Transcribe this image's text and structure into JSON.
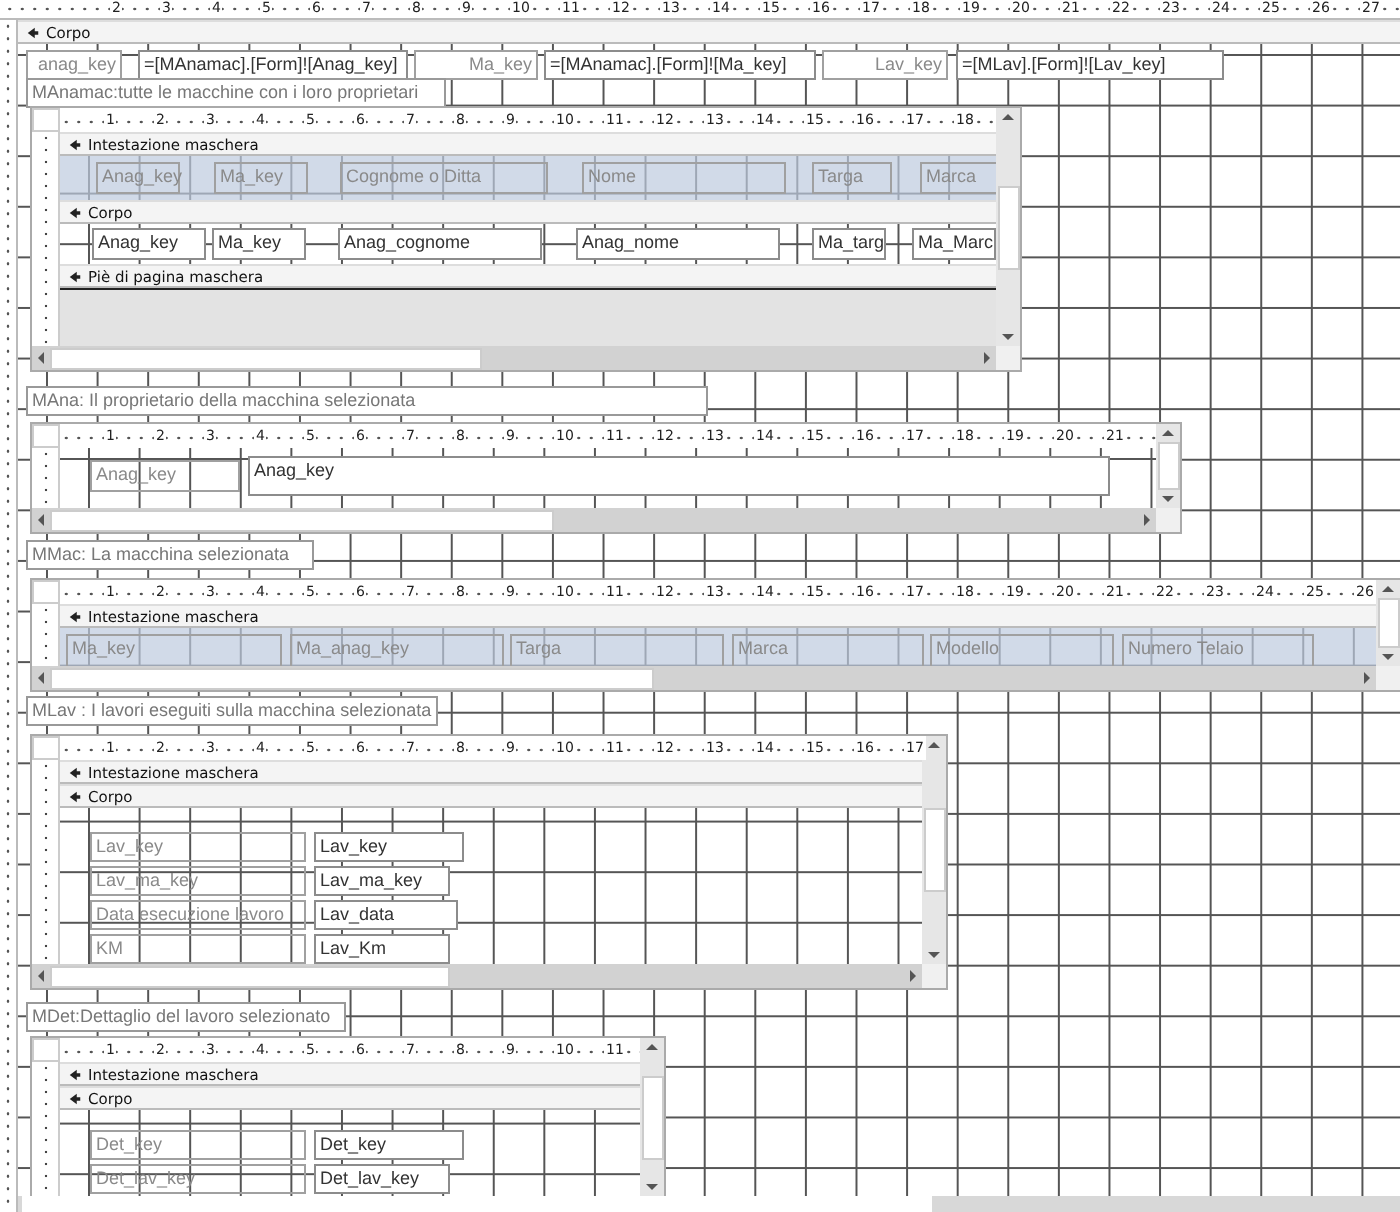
{
  "ruler": [
    "2",
    "3",
    "4",
    "5",
    "6",
    "7",
    "8",
    "9",
    "10",
    "11",
    "12",
    "13",
    "14",
    "15",
    "16",
    "17",
    "18",
    "19",
    "20",
    "21",
    "22",
    "23",
    "24",
    "25",
    "26",
    "27"
  ],
  "section": {
    "title": "Corpo"
  },
  "unbound_fields": [
    {
      "label": "anag_key",
      "expression": "=[MAnamac].[Form]![Anag_key]"
    },
    {
      "label": "Ma_key",
      "expression": "=[MAnamac].[Form]![Ma_key]"
    },
    {
      "label": "Lav_key",
      "expression": "=[MLav].[Form]![Lav_key]"
    }
  ],
  "subforms": [
    {
      "caption": "MAnamac:tutte le macchine con i loro proprietari",
      "ruler": [
        "1",
        "2",
        "3",
        "4",
        "5",
        "6",
        "7",
        "8",
        "9",
        "10",
        "11",
        "12",
        "13",
        "14",
        "15",
        "16",
        "17",
        "18"
      ],
      "sections": [
        {
          "title": "Intestazione maschera",
          "controls": [
            {
              "kind": "label",
              "text": "Anag_key"
            },
            {
              "kind": "label",
              "text": "Ma_key"
            },
            {
              "kind": "label",
              "text": "Cognome o Ditta"
            },
            {
              "kind": "label",
              "text": "Nome"
            },
            {
              "kind": "label",
              "text": "Targa"
            },
            {
              "kind": "label",
              "text": "Marca"
            }
          ]
        },
        {
          "title": "Corpo",
          "controls": [
            {
              "kind": "textbox",
              "text": "Anag_key"
            },
            {
              "kind": "textbox",
              "text": "Ma_key"
            },
            {
              "kind": "textbox",
              "text": "Anag_cognome"
            },
            {
              "kind": "textbox",
              "text": "Anag_nome"
            },
            {
              "kind": "textbox",
              "text": "Ma_targ"
            },
            {
              "kind": "textbox",
              "text": "Ma_Marc"
            }
          ]
        },
        {
          "title": "Piè di pagina maschera"
        }
      ]
    },
    {
      "caption": "MAna: Il proprietario della macchina selezionata",
      "ruler": [
        "1",
        "2",
        "3",
        "4",
        "5",
        "6",
        "7",
        "8",
        "9",
        "10",
        "11",
        "12",
        "13",
        "14",
        "15",
        "16",
        "17",
        "18",
        "19",
        "20",
        "21"
      ],
      "sections": [
        {
          "controls": [
            {
              "kind": "label",
              "text": "Anag_key"
            },
            {
              "kind": "textbox",
              "text": "Anag_key"
            }
          ]
        }
      ]
    },
    {
      "caption": "MMac: La macchina selezionata",
      "ruler": [
        "1",
        "2",
        "3",
        "4",
        "5",
        "6",
        "7",
        "8",
        "9",
        "10",
        "11",
        "12",
        "13",
        "14",
        "15",
        "16",
        "17",
        "18",
        "19",
        "20",
        "21",
        "22",
        "23",
        "24",
        "25",
        "26"
      ],
      "sections": [
        {
          "title": "Intestazione maschera",
          "controls": [
            {
              "kind": "label",
              "text": "Ma_key"
            },
            {
              "kind": "label",
              "text": "Ma_anag_key"
            },
            {
              "kind": "label",
              "text": "Targa"
            },
            {
              "kind": "label",
              "text": "Marca"
            },
            {
              "kind": "label",
              "text": "Modello"
            },
            {
              "kind": "label",
              "text": "Numero Telaio"
            }
          ]
        }
      ]
    },
    {
      "caption": "MLav : I lavori eseguiti sulla macchina selezionata",
      "ruler": [
        "1",
        "2",
        "3",
        "4",
        "5",
        "6",
        "7",
        "8",
        "9",
        "10",
        "11",
        "12",
        "13",
        "14",
        "15",
        "16",
        "17"
      ],
      "sections": [
        {
          "title": "Intestazione maschera"
        },
        {
          "title": "Corpo",
          "controls": [
            {
              "kind": "label",
              "text": "Lav_key"
            },
            {
              "kind": "textbox",
              "text": "Lav_key"
            },
            {
              "kind": "label",
              "text": "Lav_ma_key"
            },
            {
              "kind": "textbox",
              "text": "Lav_ma_key"
            },
            {
              "kind": "label",
              "text": "Data esecuzione lavoro"
            },
            {
              "kind": "textbox",
              "text": "Lav_data"
            },
            {
              "kind": "label",
              "text": "KM"
            },
            {
              "kind": "textbox",
              "text": "Lav_Km"
            }
          ]
        }
      ]
    },
    {
      "caption": "MDet:Dettaglio del lavoro selezionato",
      "ruler": [
        "1",
        "2",
        "3",
        "4",
        "5",
        "6",
        "7",
        "8",
        "9",
        "10",
        "11"
      ],
      "sections": [
        {
          "title": "Intestazione maschera"
        },
        {
          "title": "Corpo",
          "controls": [
            {
              "kind": "label",
              "text": "Det_key"
            },
            {
              "kind": "textbox",
              "text": "Det_key"
            },
            {
              "kind": "label",
              "text": "Det_lav_key"
            },
            {
              "kind": "textbox",
              "text": "Det_lav_key"
            }
          ]
        }
      ]
    }
  ]
}
